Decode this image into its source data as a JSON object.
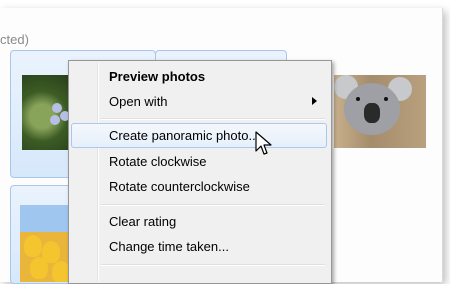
{
  "header": {
    "text": "cted)"
  },
  "thumbnails": [
    {
      "name": "flower-thumbnail-icon"
    },
    {
      "name": "koala-thumbnail-icon"
    },
    {
      "name": "tulips-thumbnail-icon"
    }
  ],
  "context_menu": {
    "items": [
      {
        "label": "Preview photos",
        "bold": true
      },
      {
        "label": "Open with",
        "submenu": true
      },
      {
        "label": "Create panoramic photo...",
        "highlighted": true
      },
      {
        "label": "Rotate clockwise"
      },
      {
        "label": "Rotate counterclockwise"
      },
      {
        "label": "Clear rating"
      },
      {
        "label": "Change time taken..."
      }
    ]
  },
  "colors": {
    "selection_border": "#a9c7ea",
    "menu_background": "#f0f0f0",
    "highlight_border": "#a8c8ee"
  }
}
